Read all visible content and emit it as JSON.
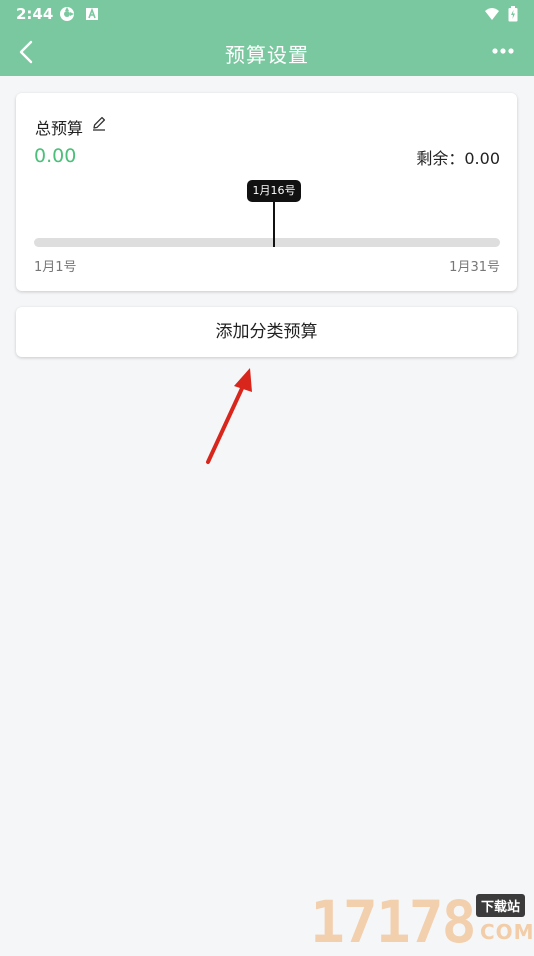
{
  "status_bar": {
    "time": "2:44",
    "icons": [
      "sync-icon",
      "font-app-icon",
      "wifi-icon",
      "battery-icon"
    ]
  },
  "app_bar": {
    "title": "预算设置",
    "back_icon": "chevron-left-icon",
    "more_icon": "more-horizontal-icon"
  },
  "budget_card": {
    "label": "总预算",
    "edit_icon": "pencil-icon",
    "amount": "0.00",
    "remaining_label": "剩余：",
    "remaining_value": "0.00",
    "today_marker": "1月16号",
    "range_start": "1月1号",
    "range_end": "1月31号",
    "amount_color": "#4cbf7a"
  },
  "add_category_button": {
    "label": "添加分类预算"
  },
  "annotation": {
    "arrow_color": "#d9261c"
  },
  "watermark": {
    "digits": "17178",
    "badge": "下载站",
    "suffix": "COM"
  },
  "colors": {
    "header": "#7ac89f",
    "background": "#f5f6f8"
  }
}
